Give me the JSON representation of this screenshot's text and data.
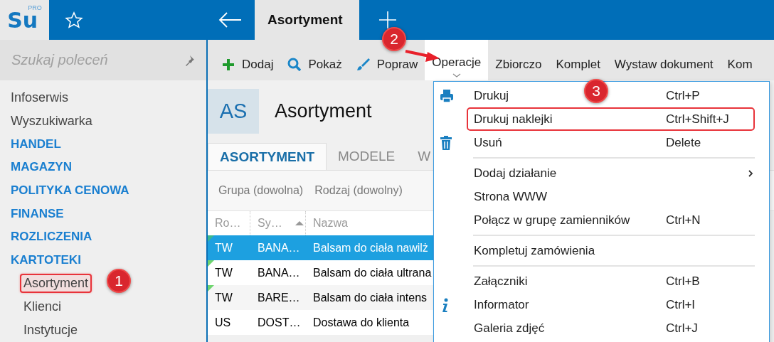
{
  "app": {
    "logo": "Su",
    "logo_badge": "PRO"
  },
  "tabs": [
    {
      "label": "Asortyment",
      "selected": true
    }
  ],
  "sidebar": {
    "search_placeholder": "Szukaj poleceń",
    "items": [
      {
        "label": "Infoserwis",
        "kind": "link"
      },
      {
        "label": "Wyszukiwarka",
        "kind": "link"
      },
      {
        "label": "HANDEL",
        "kind": "section"
      },
      {
        "label": "MAGAZYN",
        "kind": "section"
      },
      {
        "label": "POLITYKA CENOWA",
        "kind": "section"
      },
      {
        "label": "FINANSE",
        "kind": "section"
      },
      {
        "label": "ROZLICZENIA",
        "kind": "section"
      },
      {
        "label": "KARTOTEKI",
        "kind": "section",
        "children": [
          {
            "label": "Asortyment",
            "highlighted": true
          },
          {
            "label": "Klienci",
            "highlighted": false
          },
          {
            "label": "Instytucje",
            "highlighted": false
          }
        ]
      }
    ]
  },
  "toolbar": [
    {
      "label": "Dodaj",
      "kind": "add",
      "open": false
    },
    {
      "label": "Pokaż",
      "kind": "show",
      "open": false
    },
    {
      "label": "Popraw",
      "kind": "edit",
      "open": false
    },
    {
      "label": "Operacje",
      "kind": "plain",
      "open": true
    },
    {
      "label": "Zbiorczo",
      "kind": "plain",
      "open": false
    },
    {
      "label": "Komplet",
      "kind": "plain",
      "open": false
    },
    {
      "label": "Wystaw dokument",
      "kind": "plain",
      "open": false
    },
    {
      "label": "Kom",
      "kind": "plain",
      "open": false
    }
  ],
  "page": {
    "badge": "AS",
    "title": "Asortyment"
  },
  "view_tabs": [
    {
      "label": "ASORTYMENT",
      "selected": true
    },
    {
      "label": "MODELE",
      "selected": false
    },
    {
      "label": "W",
      "selected": false
    }
  ],
  "filters": [
    "Grupa (dowolna)",
    "Rodzaj (dowolny)"
  ],
  "table": {
    "columns": [
      {
        "label": "Ro…",
        "sorted": false
      },
      {
        "label": "Sy…",
        "sorted": true
      },
      {
        "label": "Nazwa",
        "sorted": false
      }
    ],
    "rows": [
      {
        "cells": [
          "TW",
          "BANA…",
          "Balsam do ciała nawilż"
        ],
        "selected": true,
        "flagged": true
      },
      {
        "cells": [
          "TW",
          "BANA…",
          "Balsam do ciała ultrana"
        ],
        "selected": false,
        "flagged": true
      },
      {
        "cells": [
          "TW",
          "BARE…",
          "Balsam do ciała intens"
        ],
        "selected": false,
        "flagged": true
      },
      {
        "cells": [
          "US",
          "DOST…",
          "Dostawa do klienta"
        ],
        "selected": false,
        "flagged": false
      }
    ]
  },
  "menu": {
    "items": [
      {
        "kind": "print",
        "label": "Drukuj",
        "shortcut": "Ctrl+P",
        "highlighted": false,
        "submenu": false
      },
      {
        "kind": "plain",
        "label": "Drukuj naklejki",
        "shortcut": "Ctrl+Shift+J",
        "highlighted": true,
        "submenu": false
      },
      {
        "kind": "delete",
        "label": "Usuń",
        "shortcut": "Delete",
        "highlighted": false,
        "submenu": false
      },
      {
        "kind": "separator"
      },
      {
        "kind": "plain",
        "label": "Dodaj działanie",
        "highlighted": false,
        "submenu": true
      },
      {
        "kind": "plain",
        "label": "Strona WWW",
        "highlighted": false,
        "submenu": false
      },
      {
        "kind": "plain",
        "label": "Połącz w grupę zamienników",
        "shortcut": "Ctrl+N",
        "highlighted": false,
        "submenu": false
      },
      {
        "kind": "separator"
      },
      {
        "kind": "plain",
        "label": "Kompletuj zamówienia",
        "highlighted": false,
        "submenu": false
      },
      {
        "kind": "separator"
      },
      {
        "kind": "plain",
        "label": "Załączniki",
        "shortcut": "Ctrl+B",
        "highlighted": false,
        "submenu": false
      },
      {
        "kind": "info",
        "label": "Informator",
        "shortcut": "Ctrl+I",
        "highlighted": false,
        "submenu": false
      },
      {
        "kind": "plain",
        "label": "Galeria zdjęć",
        "shortcut": "Ctrl+J",
        "highlighted": false,
        "submenu": false
      }
    ]
  },
  "annotations": [
    {
      "label": "1"
    },
    {
      "label": "2"
    },
    {
      "label": "3"
    }
  ]
}
